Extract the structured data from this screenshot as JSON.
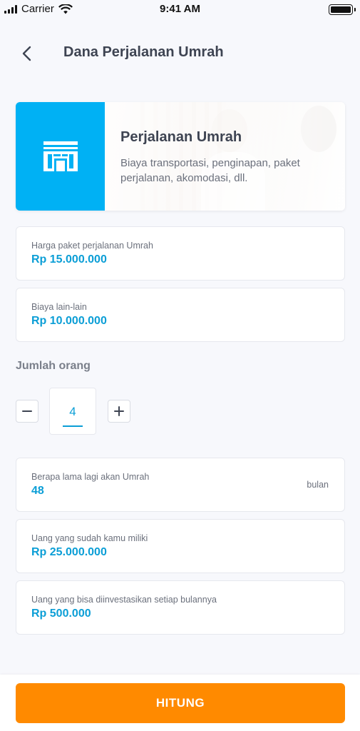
{
  "status_bar": {
    "carrier": "Carrier",
    "time": "9:41 AM"
  },
  "header": {
    "title": "Dana Perjalanan Umrah"
  },
  "banner": {
    "title": "Perjalanan Umrah",
    "description": "Biaya transportasi, penginapan, paket perjalanan, akomodasi, dll.",
    "icon": "kaaba-icon",
    "accent_color": "#00b1f4"
  },
  "fields": {
    "package_price": {
      "label": "Harga paket perjalanan Umrah",
      "value": "Rp 15.000.000"
    },
    "other_costs": {
      "label": "Biaya lain-lain",
      "value": "Rp 10.000.000"
    },
    "duration": {
      "label": "Berapa lama lagi akan Umrah",
      "value": "48",
      "suffix": "bulan"
    },
    "savings": {
      "label": "Uang yang sudah kamu miliki",
      "value": "Rp 25.000.000"
    },
    "monthly_invest": {
      "label": "Uang yang bisa diinvestasikan setiap bulannya",
      "value": "Rp 500.000"
    }
  },
  "people": {
    "label": "Jumlah orang",
    "value": "4"
  },
  "footer": {
    "button_label": "HITUNG",
    "button_color": "#ff8a00"
  }
}
